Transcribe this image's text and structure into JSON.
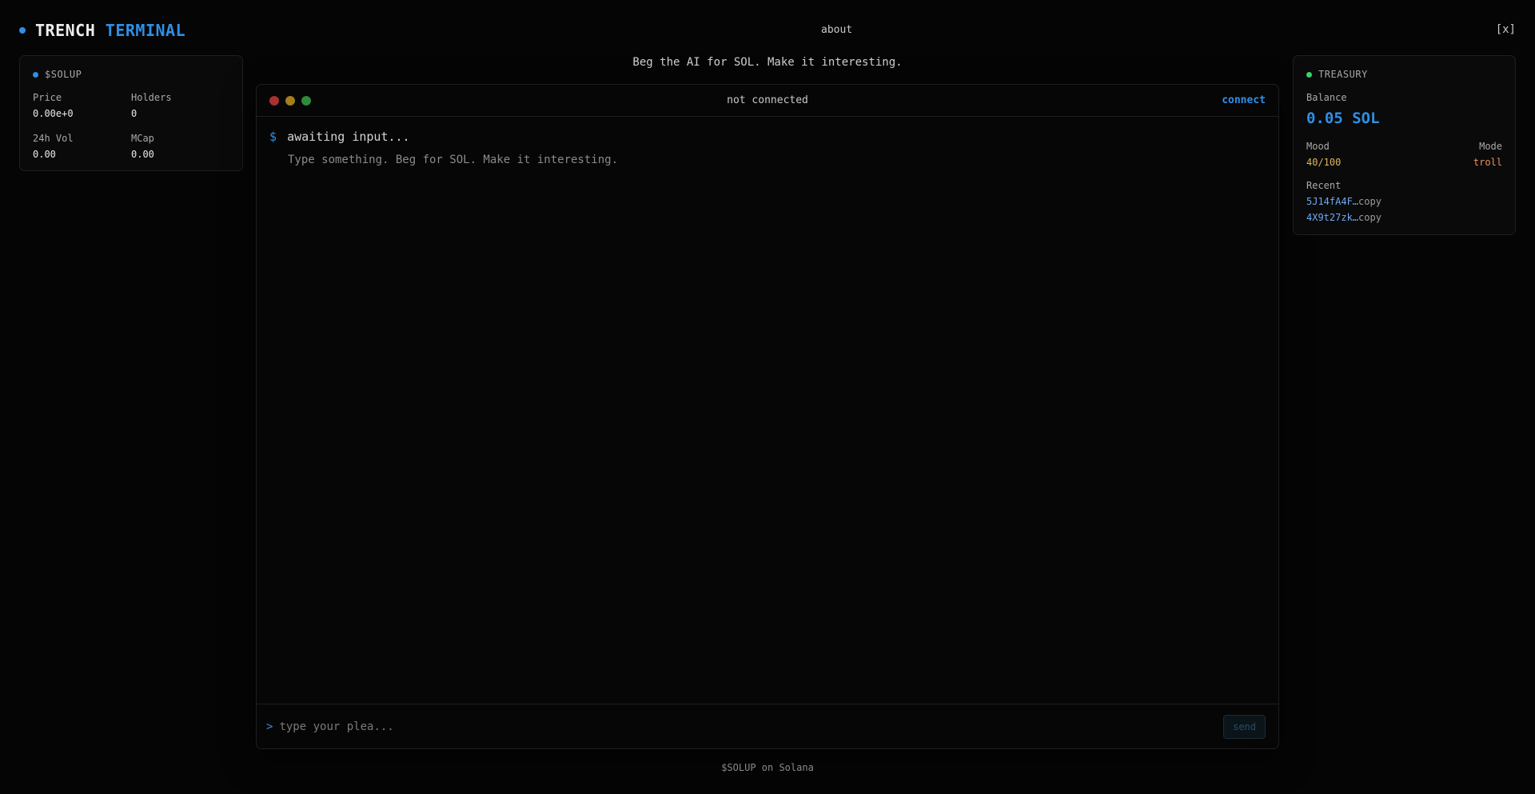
{
  "header": {
    "brand_part1": "TRENCH",
    "brand_part2": "TERMINAL",
    "nav_about": "about",
    "nav_close": "[x]"
  },
  "tagline": "Beg the AI for SOL. Make it interesting.",
  "token_panel": {
    "title": "$SOLUP",
    "stats": [
      {
        "label": "Price",
        "value": "0.00e+0"
      },
      {
        "label": "Holders",
        "value": "0"
      },
      {
        "label": "24h Vol",
        "value": "0.00"
      },
      {
        "label": "MCap",
        "value": "0.00"
      }
    ]
  },
  "treasury_panel": {
    "title": "TREASURY",
    "balance_label": "Balance",
    "balance_value": "0.05 SOL",
    "mood_label": "Mood",
    "mood_value": "40/100",
    "mode_label": "Mode",
    "mode_value": "troll",
    "recent_label": "Recent",
    "recent": [
      {
        "tx": "5J14fA4F…",
        "action": "copy"
      },
      {
        "tx": "4X9t27zk…",
        "action": "copy"
      }
    ]
  },
  "terminal": {
    "status": "not connected",
    "connect_label": "connect",
    "prompt_symbol": "$",
    "prompt_text": "awaiting input...",
    "hint": "Type something. Beg for SOL. Make it interesting.",
    "input_caret": ">",
    "input_placeholder": "type your plea...",
    "input_value": "",
    "send_label": "send"
  },
  "footer": "$SOLUP on Solana",
  "colors": {
    "accent": "#2f8fe6",
    "background": "#050505",
    "mood": "#e0b55a",
    "mode": "#f0935a",
    "treasury_dot": "#3ecf6e"
  }
}
